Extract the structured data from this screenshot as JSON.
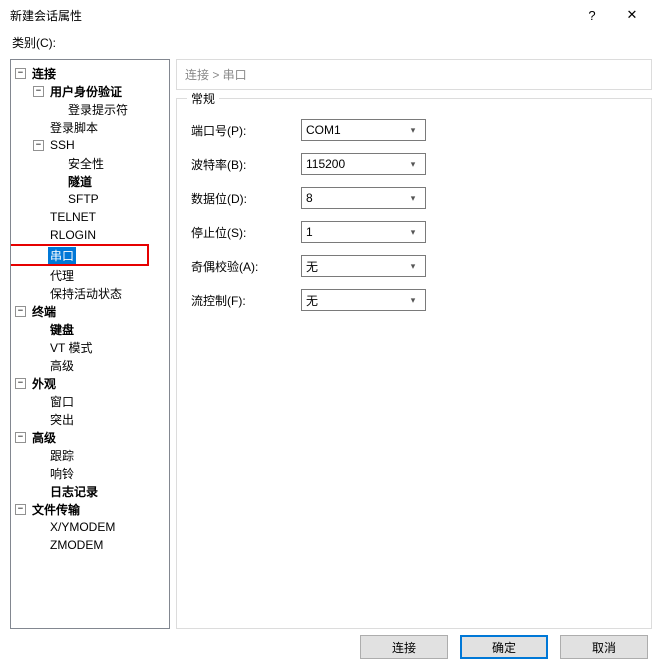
{
  "title": "新建会话属性",
  "category_label": "类别(C):",
  "breadcrumb": "连接  >  串口",
  "group_title": "常规",
  "fields": {
    "port": {
      "label": "端口号(P):",
      "value": "COM1"
    },
    "baud": {
      "label": "波特率(B):",
      "value": "115200"
    },
    "databits": {
      "label": "数据位(D):",
      "value": "8"
    },
    "stopbits": {
      "label": "停止位(S):",
      "value": "1"
    },
    "parity": {
      "label": "奇偶校验(A):",
      "value": "无"
    },
    "flowctrl": {
      "label": "流控制(F):",
      "value": "无"
    }
  },
  "buttons": {
    "connect": "连接",
    "ok": "确定",
    "cancel": "取消"
  },
  "tree": {
    "conn": "连接",
    "userauth": "用户身份验证",
    "loginprompt": "登录提示符",
    "loginscript": "登录脚本",
    "ssh": "SSH",
    "security": "安全性",
    "tunnel": "隧道",
    "sftp": "SFTP",
    "telnet": "TELNET",
    "rlogin": "RLOGIN",
    "serial": "串口",
    "proxy": "代理",
    "keepalive": "保持活动状态",
    "terminal": "终端",
    "keyboard": "键盘",
    "vtmode": "VT 模式",
    "advanced_t": "高级",
    "appearance": "外观",
    "window": "窗口",
    "highlight": "突出",
    "advanced": "高级",
    "trace": "跟踪",
    "bell": "响铃",
    "log": "日志记录",
    "filetransfer": "文件传输",
    "xymodem": "X/YMODEM",
    "zmodem": "ZMODEM"
  }
}
